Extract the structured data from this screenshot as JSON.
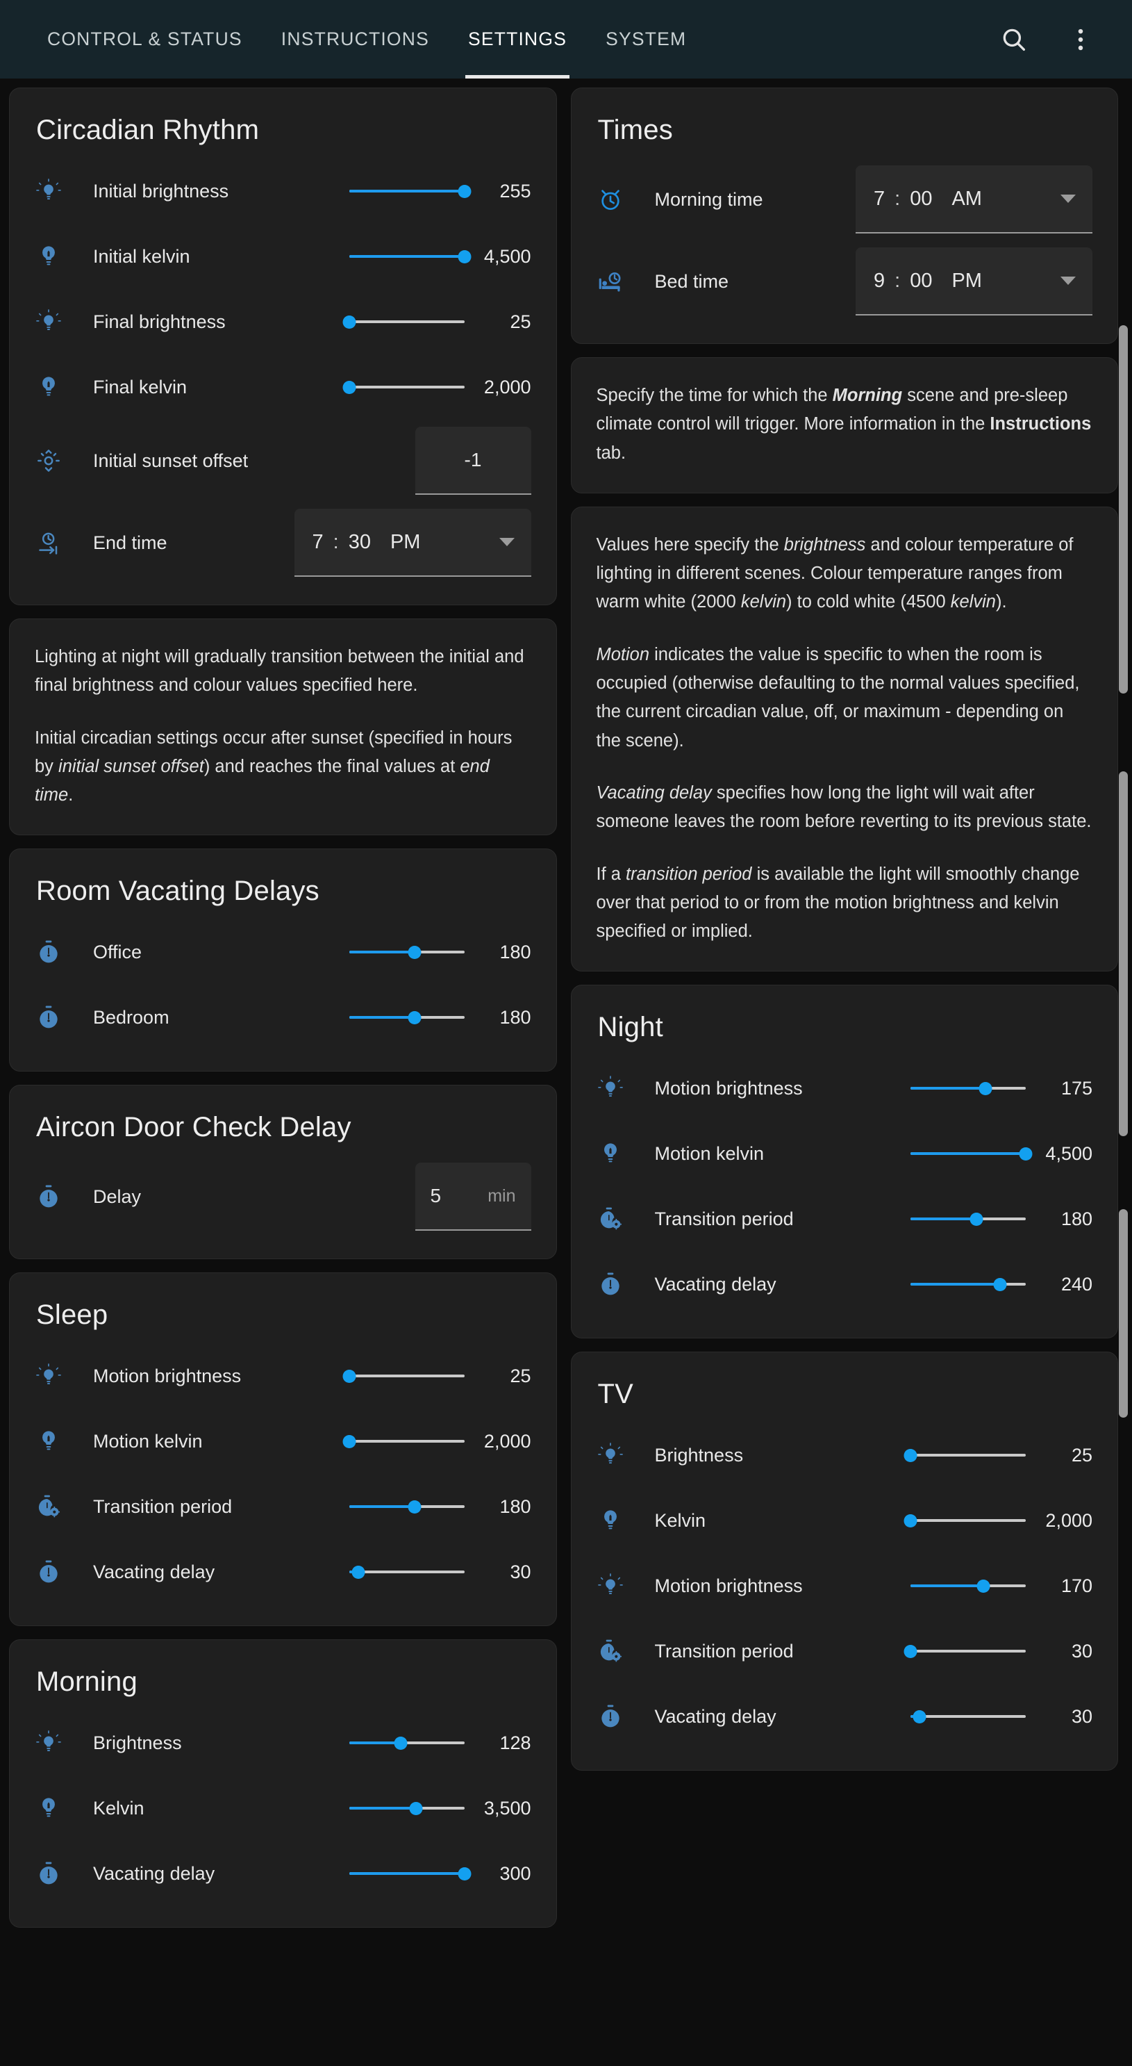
{
  "header": {
    "tabs": [
      {
        "label": "CONTROL & STATUS",
        "active": false
      },
      {
        "label": "INSTRUCTIONS",
        "active": false
      },
      {
        "label": "SETTINGS",
        "active": true
      },
      {
        "label": "SYSTEM",
        "active": false
      }
    ],
    "search_icon": "search-icon",
    "overflow_icon": "more-vert-icon"
  },
  "circadian": {
    "title": "Circadian Rhythm",
    "rows": [
      {
        "icon": "brightness-bulb-icon",
        "label": "Initial brightness",
        "value": "255",
        "pct": 100
      },
      {
        "icon": "kelvin-bulb-icon",
        "label": "Initial kelvin",
        "value": "4,500",
        "pct": 100
      },
      {
        "icon": "brightness-bulb-icon",
        "label": "Final brightness",
        "value": "25",
        "pct": 0
      },
      {
        "icon": "kelvin-bulb-icon",
        "label": "Final kelvin",
        "value": "2,000",
        "pct": 0
      }
    ],
    "sunset_offset": {
      "icon": "sunset-offset-icon",
      "label": "Initial sunset offset",
      "value": "-1"
    },
    "end_time": {
      "icon": "end-time-icon",
      "label": "End time",
      "hour": "7",
      "colon": ":",
      "minute": "30",
      "ampm": "PM"
    }
  },
  "circadian_note": {
    "p1_a": "Lighting at night will gradually transition between the initial and final brightness and colour values specified here.",
    "p2_a": "Initial circadian settings occur after sunset (specified in hours by ",
    "p2_i": "initial sunset offset",
    "p2_b": ") and reaches the final values at ",
    "p2_i2": "end time",
    "p2_c": "."
  },
  "room_vacating": {
    "title": "Room Vacating Delays",
    "rows": [
      {
        "icon": "stopwatch-icon",
        "label": "Office",
        "value": "180",
        "pct": 57
      },
      {
        "icon": "stopwatch-icon",
        "label": "Bedroom",
        "value": "180",
        "pct": 57
      }
    ]
  },
  "aircon": {
    "title": "Aircon Door Check Delay",
    "row": {
      "icon": "stopwatch-icon",
      "label": "Delay",
      "value": "5",
      "unit": "min"
    }
  },
  "sleep": {
    "title": "Sleep",
    "rows": [
      {
        "icon": "brightness-bulb-icon",
        "label": "Motion brightness",
        "value": "25",
        "pct": 0
      },
      {
        "icon": "kelvin-bulb-icon",
        "label": "Motion kelvin",
        "value": "2,000",
        "pct": 0
      },
      {
        "icon": "transition-period-icon",
        "label": "Transition period",
        "value": "180",
        "pct": 57
      },
      {
        "icon": "stopwatch-icon",
        "label": "Vacating delay",
        "value": "30",
        "pct": 8
      }
    ]
  },
  "morning": {
    "title": "Morning",
    "rows": [
      {
        "icon": "brightness-bulb-icon",
        "label": "Brightness",
        "value": "128",
        "pct": 45
      },
      {
        "icon": "kelvin-bulb-icon",
        "label": "Kelvin",
        "value": "3,500",
        "pct": 58
      },
      {
        "icon": "stopwatch-icon",
        "label": "Vacating delay",
        "value": "300",
        "pct": 100
      }
    ]
  },
  "times": {
    "title": "Times",
    "rows": [
      {
        "icon": "alarm-clock-icon",
        "label": "Morning time",
        "hour": "7",
        "colon": ":",
        "minute": "00",
        "ampm": "AM"
      },
      {
        "icon": "bed-time-icon",
        "label": "Bed time",
        "hour": "9",
        "colon": ":",
        "minute": "00",
        "ampm": "PM"
      }
    ]
  },
  "times_note": {
    "a": "Specify the time for which the ",
    "bi": "Morning",
    "b": " scene and pre-sleep climate control will trigger. More information in the ",
    "c": "Instructions",
    "d": " tab."
  },
  "values_note": {
    "p1_a": "Values here specify the ",
    "p1_i1": "brightness",
    "p1_b": " and colour temperature of lighting in different scenes. Colour temperature ranges from warm white (2000 ",
    "p1_i2": "kelvin",
    "p1_c": ") to cold white (4500 ",
    "p1_i3": "kelvin",
    "p1_d": ").",
    "p2_i": "Motion",
    "p2_a": " indicates the value is specific to when the room is occupied (otherwise defaulting to the normal values specified, the current circadian value, off, or maximum - depending on the scene).",
    "p3_i": "Vacating delay",
    "p3_a": " specifies how long the light will wait after someone leaves the room before reverting to its previous state.",
    "p4_a": "If a ",
    "p4_i": "transition period",
    "p4_b": " is available the light will smoothly change over that period to or from the motion brightness and kelvin specified or implied."
  },
  "night": {
    "title": "Night",
    "rows": [
      {
        "icon": "brightness-bulb-icon",
        "label": "Motion brightness",
        "value": "175",
        "pct": 65
      },
      {
        "icon": "kelvin-bulb-icon",
        "label": "Motion kelvin",
        "value": "4,500",
        "pct": 100
      },
      {
        "icon": "transition-period-icon",
        "label": "Transition period",
        "value": "180",
        "pct": 57
      },
      {
        "icon": "stopwatch-icon",
        "label": "Vacating delay",
        "value": "240",
        "pct": 78
      }
    ]
  },
  "tv": {
    "title": "TV",
    "rows": [
      {
        "icon": "brightness-bulb-icon",
        "label": "Brightness",
        "value": "25",
        "pct": 0
      },
      {
        "icon": "kelvin-bulb-icon",
        "label": "Kelvin",
        "value": "2,000",
        "pct": 0
      },
      {
        "icon": "brightness-bulb-icon",
        "label": "Motion brightness",
        "value": "170",
        "pct": 63
      },
      {
        "icon": "transition-period-icon",
        "label": "Transition period",
        "value": "30",
        "pct": 0
      },
      {
        "icon": "stopwatch-icon",
        "label": "Vacating delay",
        "value": "30",
        "pct": 8
      }
    ]
  },
  "colors": {
    "accent": "#13a0f0",
    "icon_blue": "#4a87bf",
    "header_bg": "#16252b",
    "card_bg": "#1f1f1f",
    "page_bg": "#0d0d0d"
  }
}
